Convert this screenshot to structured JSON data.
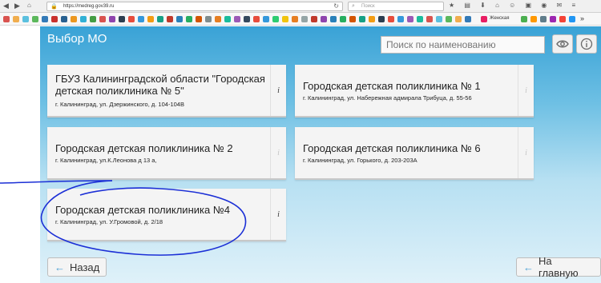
{
  "browser": {
    "url": "https://medreg.gov39.ru",
    "search_placeholder": "Поиск",
    "bookmark_label": "Женская"
  },
  "page": {
    "title": "Выбор МО",
    "search_placeholder": "Поиск по наименованию"
  },
  "cards": [
    {
      "name": "ГБУЗ Калининградской области \"Городская детская поликлиника № 5\"",
      "address": "г. Калининград, ул. Дзержинского, д. 104-104В",
      "info": "i"
    },
    {
      "name": "Городская детская поликлиника № 1",
      "address": "г. Калининград, ул. Набережная адмирала Трибуца, д. 55-56",
      "info": "i"
    },
    {
      "name": "Городская детская поликлиника № 2",
      "address": "г. Калининград, ул.К.Леонова д 13 а,",
      "info": "i"
    },
    {
      "name": "Городская детская поликлиника № 6",
      "address": "г. Калининград, ул. Горького, д. 203-203А",
      "info": "i"
    },
    {
      "name": "Городская детская поликлиника №4",
      "address": "г. Калининград, ул. У.Громовой, д. 2/18",
      "info": "i"
    }
  ],
  "buttons": {
    "back": "Назад",
    "home": "На главную"
  },
  "icons": {
    "view": "eye-icon",
    "info": "info-icon"
  },
  "colors": {
    "header_blue": "#39a2d6",
    "annotation_blue": "#1b2fd6",
    "accent_arrow": "#4a9fd4"
  }
}
